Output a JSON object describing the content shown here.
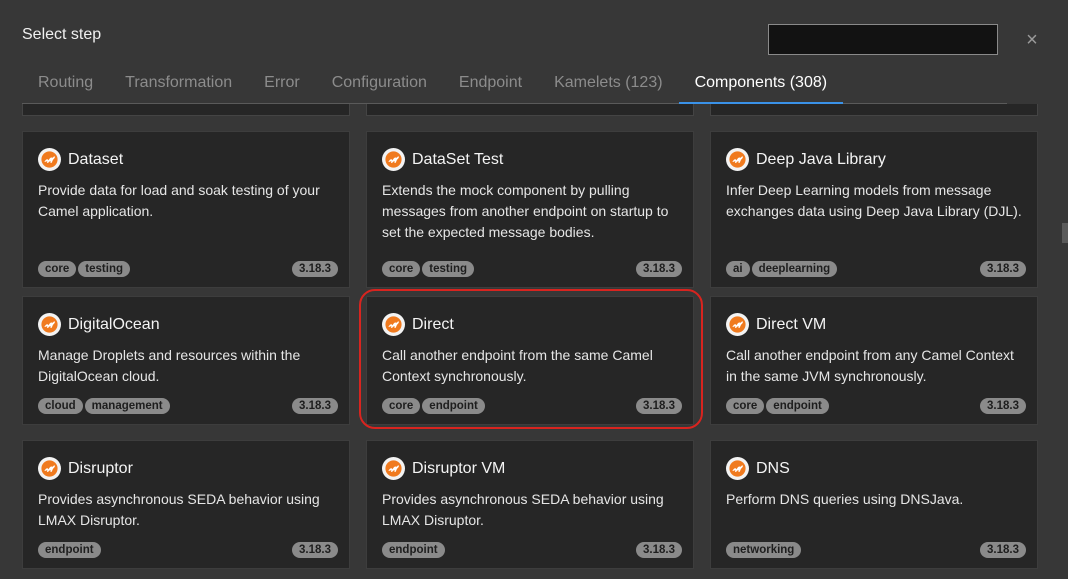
{
  "modal": {
    "title": "Select step",
    "search_value": ""
  },
  "tabs": [
    {
      "label": "Routing",
      "active": false
    },
    {
      "label": "Transformation",
      "active": false
    },
    {
      "label": "Error",
      "active": false
    },
    {
      "label": "Configuration",
      "active": false
    },
    {
      "label": "Endpoint",
      "active": false
    },
    {
      "label": "Kamelets (123)",
      "active": false
    },
    {
      "label": "Components (308)",
      "active": true
    }
  ],
  "cards": [
    {
      "title": "Dataset",
      "description": "Provide data for load and soak testing of your Camel application.",
      "labels": [
        "core",
        "testing"
      ],
      "version": "3.18.3"
    },
    {
      "title": "DataSet Test",
      "description": "Extends the mock component by pulling messages from another endpoint on startup to set the expected message bodies.",
      "labels": [
        "core",
        "testing"
      ],
      "version": "3.18.3"
    },
    {
      "title": "Deep Java Library",
      "description": "Infer Deep Learning models from message exchanges data using Deep Java Library (DJL).",
      "labels": [
        "ai",
        "deeplearning"
      ],
      "version": "3.18.3"
    },
    {
      "title": "DigitalOcean",
      "description": "Manage Droplets and resources within the DigitalOcean cloud.",
      "labels": [
        "cloud",
        "management"
      ],
      "version": "3.18.3"
    },
    {
      "title": "Direct",
      "description": "Call another endpoint from the same Camel Context synchronously.",
      "labels": [
        "core",
        "endpoint"
      ],
      "version": "3.18.3",
      "highlighted": true
    },
    {
      "title": "Direct VM",
      "description": "Call another endpoint from any Camel Context in the same JVM synchronously.",
      "labels": [
        "core",
        "endpoint"
      ],
      "version": "3.18.3"
    },
    {
      "title": "Disruptor",
      "description": "Provides asynchronous SEDA behavior using LMAX Disruptor.",
      "labels": [
        "endpoint"
      ],
      "version": "3.18.3"
    },
    {
      "title": "Disruptor VM",
      "description": "Provides asynchronous SEDA behavior using LMAX Disruptor.",
      "labels": [
        "endpoint"
      ],
      "version": "3.18.3"
    },
    {
      "title": "DNS",
      "description": "Perform DNS queries using DNSJava.",
      "labels": [
        "networking"
      ],
      "version": "3.18.3"
    }
  ],
  "colors": {
    "background": "#373737",
    "card": "#262626",
    "accent": "#3a92e8",
    "highlight": "#d8241f",
    "camel_orange": "#f07a1e"
  },
  "icons": {
    "card_icon": "apache-camel-icon",
    "close": "close-icon"
  }
}
